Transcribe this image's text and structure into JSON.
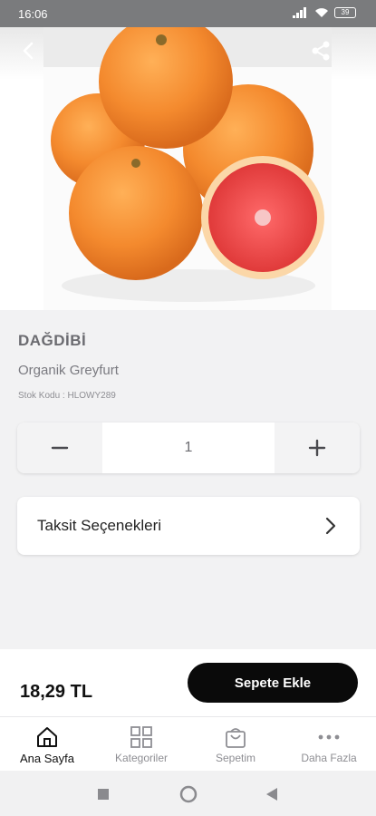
{
  "status_bar": {
    "time": "16:06",
    "battery": "39"
  },
  "product": {
    "brand": "DAĞDİBİ",
    "name": "Organik Greyfurt",
    "stock_code": "Stok Kodu : HLOWY289",
    "quantity": "1",
    "installments_label": "Taksit Seçenekleri",
    "price": "18,29 TL",
    "add_to_cart_label": "Sepete Ekle"
  },
  "tabs": [
    {
      "label": "Ana Sayfa",
      "icon": "home-icon",
      "active": true
    },
    {
      "label": "Kategoriler",
      "icon": "grid-icon",
      "active": false
    },
    {
      "label": "Sepetim",
      "icon": "bag-icon",
      "active": false
    },
    {
      "label": "Daha Fazla",
      "icon": "more-icon",
      "active": false
    }
  ],
  "colors": {
    "accent": "#0a0a0a",
    "background": "#f2f2f3"
  }
}
